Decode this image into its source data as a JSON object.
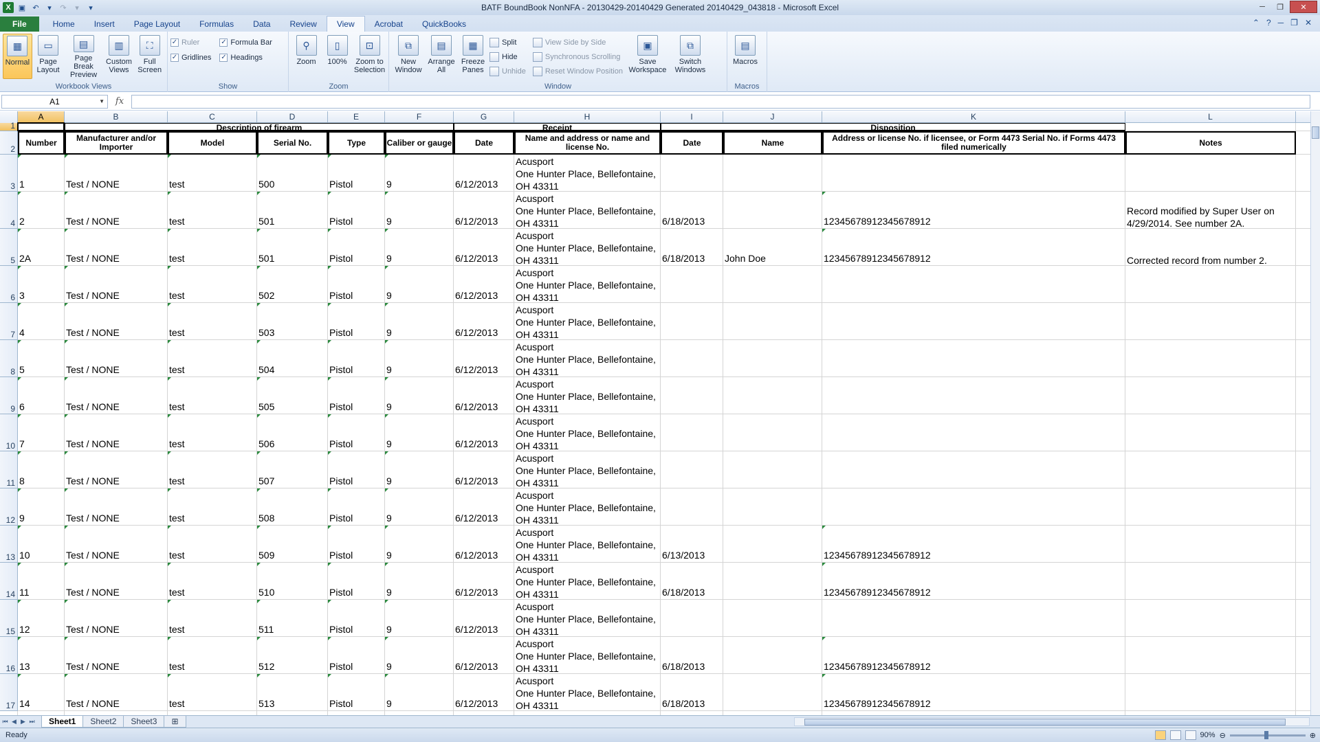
{
  "window": {
    "title": "BATF BoundBook NonNFA - 20130429-20140429 Generated 20140429_043818  -  Microsoft Excel"
  },
  "tabs": [
    "File",
    "Home",
    "Insert",
    "Page Layout",
    "Formulas",
    "Data",
    "Review",
    "View",
    "Acrobat",
    "QuickBooks"
  ],
  "active_tab": "View",
  "ribbon": {
    "workbook_views": {
      "label": "Workbook Views",
      "normal": "Normal",
      "page_layout_1": "Page",
      "page_layout_2": "Layout",
      "page_break_1": "Page Break",
      "page_break_2": "Preview",
      "custom_1": "Custom",
      "custom_2": "Views",
      "full_1": "Full",
      "full_2": "Screen"
    },
    "show": {
      "label": "Show",
      "ruler": "Ruler",
      "formula_bar": "Formula Bar",
      "gridlines": "Gridlines",
      "headings": "Headings"
    },
    "zoom": {
      "label": "Zoom",
      "zoom": "Zoom",
      "hundred": "100%",
      "zoom_sel_1": "Zoom to",
      "zoom_sel_2": "Selection"
    },
    "window": {
      "label": "Window",
      "new_1": "New",
      "new_2": "Window",
      "arrange_1": "Arrange",
      "arrange_2": "All",
      "freeze_1": "Freeze",
      "freeze_2": "Panes",
      "split": "Split",
      "hide": "Hide",
      "unhide": "Unhide",
      "side_by_side": "View Side by Side",
      "sync_scroll": "Synchronous Scrolling",
      "reset_pos": "Reset Window Position",
      "save_ws_1": "Save",
      "save_ws_2": "Workspace",
      "switch_1": "Switch",
      "switch_2": "Windows"
    },
    "macros": {
      "label": "Macros",
      "macros": "Macros"
    }
  },
  "formula_bar": {
    "name_box": "A1",
    "fx": "fx",
    "formula": ""
  },
  "columns": [
    "A",
    "B",
    "C",
    "D",
    "E",
    "F",
    "G",
    "H",
    "I",
    "J",
    "K",
    "L"
  ],
  "group_headers": {
    "description": "Description of firearm",
    "receipt": "Receipt",
    "disposition": "Disposition"
  },
  "field_headers": {
    "number": "Number",
    "manufacturer": "Manufacturer and/or Importer",
    "model": "Model",
    "serial": "Serial No.",
    "type": "Type",
    "caliber": "Caliber or gauge",
    "receipt_date": "Date",
    "receipt_name": "Name and address or name and license No.",
    "disp_date": "Date",
    "disp_name": "Name",
    "disp_address": "Address or license No. if licensee, or Form 4473 Serial No. if Forms 4473 filed numerically",
    "notes": "Notes"
  },
  "rows": [
    {
      "row": "3",
      "num": "1",
      "mfr": "Test / NONE",
      "model": "test",
      "serial": "500",
      "type": "Pistol",
      "cal": "9",
      "rdate": "6/12/2013",
      "addr1": "Acusport",
      "addr2": "One Hunter Place, Bellefontaine,",
      "addr3": "OH 43311",
      "ddate": "",
      "dname": "",
      "daddr": "",
      "notes1": "",
      "notes2": ""
    },
    {
      "row": "4",
      "num": "2",
      "mfr": "Test / NONE",
      "model": "test",
      "serial": "501",
      "type": "Pistol",
      "cal": "9",
      "rdate": "6/12/2013",
      "addr1": "Acusport",
      "addr2": "One Hunter Place, Bellefontaine,",
      "addr3": "OH 43311",
      "ddate": "6/18/2013",
      "dname": "",
      "daddr": "12345678912345678912",
      "notes1": "Record modified by Super User on",
      "notes2": "4/29/2014.  See number 2A."
    },
    {
      "row": "5",
      "num": "2A",
      "mfr": "Test / NONE",
      "model": "test",
      "serial": "501",
      "type": "Pistol",
      "cal": "9",
      "rdate": "6/12/2013",
      "addr1": "Acusport",
      "addr2": "One Hunter Place, Bellefontaine,",
      "addr3": "OH 43311",
      "ddate": "6/18/2013",
      "dname": "John Doe",
      "daddr": "12345678912345678912",
      "notes1": "",
      "notes2": "Corrected record from number 2."
    },
    {
      "row": "6",
      "num": "3",
      "mfr": "Test / NONE",
      "model": "test",
      "serial": "502",
      "type": "Pistol",
      "cal": "9",
      "rdate": "6/12/2013",
      "addr1": "Acusport",
      "addr2": "One Hunter Place, Bellefontaine,",
      "addr3": "OH 43311",
      "ddate": "",
      "dname": "",
      "daddr": "",
      "notes1": "",
      "notes2": ""
    },
    {
      "row": "7",
      "num": "4",
      "mfr": "Test / NONE",
      "model": "test",
      "serial": "503",
      "type": "Pistol",
      "cal": "9",
      "rdate": "6/12/2013",
      "addr1": "Acusport",
      "addr2": "One Hunter Place, Bellefontaine,",
      "addr3": "OH 43311",
      "ddate": "",
      "dname": "",
      "daddr": "",
      "notes1": "",
      "notes2": ""
    },
    {
      "row": "8",
      "num": "5",
      "mfr": "Test / NONE",
      "model": "test",
      "serial": "504",
      "type": "Pistol",
      "cal": "9",
      "rdate": "6/12/2013",
      "addr1": "Acusport",
      "addr2": "One Hunter Place, Bellefontaine,",
      "addr3": "OH 43311",
      "ddate": "",
      "dname": "",
      "daddr": "",
      "notes1": "",
      "notes2": ""
    },
    {
      "row": "9",
      "num": "6",
      "mfr": "Test / NONE",
      "model": "test",
      "serial": "505",
      "type": "Pistol",
      "cal": "9",
      "rdate": "6/12/2013",
      "addr1": "Acusport",
      "addr2": "One Hunter Place, Bellefontaine,",
      "addr3": "OH 43311",
      "ddate": "",
      "dname": "",
      "daddr": "",
      "notes1": "",
      "notes2": ""
    },
    {
      "row": "10",
      "num": "7",
      "mfr": "Test / NONE",
      "model": "test",
      "serial": "506",
      "type": "Pistol",
      "cal": "9",
      "rdate": "6/12/2013",
      "addr1": "Acusport",
      "addr2": "One Hunter Place, Bellefontaine,",
      "addr3": "OH 43311",
      "ddate": "",
      "dname": "",
      "daddr": "",
      "notes1": "",
      "notes2": ""
    },
    {
      "row": "11",
      "num": "8",
      "mfr": "Test / NONE",
      "model": "test",
      "serial": "507",
      "type": "Pistol",
      "cal": "9",
      "rdate": "6/12/2013",
      "addr1": "Acusport",
      "addr2": "One Hunter Place, Bellefontaine,",
      "addr3": "OH 43311",
      "ddate": "",
      "dname": "",
      "daddr": "",
      "notes1": "",
      "notes2": ""
    },
    {
      "row": "12",
      "num": "9",
      "mfr": "Test / NONE",
      "model": "test",
      "serial": "508",
      "type": "Pistol",
      "cal": "9",
      "rdate": "6/12/2013",
      "addr1": "Acusport",
      "addr2": "One Hunter Place, Bellefontaine,",
      "addr3": "OH 43311",
      "ddate": "",
      "dname": "",
      "daddr": "",
      "notes1": "",
      "notes2": ""
    },
    {
      "row": "13",
      "num": "10",
      "mfr": "Test / NONE",
      "model": "test",
      "serial": "509",
      "type": "Pistol",
      "cal": "9",
      "rdate": "6/12/2013",
      "addr1": "Acusport",
      "addr2": "One Hunter Place, Bellefontaine,",
      "addr3": "OH 43311",
      "ddate": "6/13/2013",
      "dname": "",
      "daddr": "12345678912345678912",
      "notes1": "",
      "notes2": ""
    },
    {
      "row": "14",
      "num": "11",
      "mfr": "Test / NONE",
      "model": "test",
      "serial": "510",
      "type": "Pistol",
      "cal": "9",
      "rdate": "6/12/2013",
      "addr1": "Acusport",
      "addr2": "One Hunter Place, Bellefontaine,",
      "addr3": "OH 43311",
      "ddate": "6/18/2013",
      "dname": "",
      "daddr": "12345678912345678912",
      "notes1": "",
      "notes2": ""
    },
    {
      "row": "15",
      "num": "12",
      "mfr": "Test / NONE",
      "model": "test",
      "serial": "511",
      "type": "Pistol",
      "cal": "9",
      "rdate": "6/12/2013",
      "addr1": "Acusport",
      "addr2": "One Hunter Place, Bellefontaine,",
      "addr3": "OH 43311",
      "ddate": "",
      "dname": "",
      "daddr": "",
      "notes1": "",
      "notes2": ""
    },
    {
      "row": "16",
      "num": "13",
      "mfr": "Test / NONE",
      "model": "test",
      "serial": "512",
      "type": "Pistol",
      "cal": "9",
      "rdate": "6/12/2013",
      "addr1": "Acusport",
      "addr2": "One Hunter Place, Bellefontaine,",
      "addr3": "OH 43311",
      "ddate": "6/18/2013",
      "dname": "",
      "daddr": "12345678912345678912",
      "notes1": "",
      "notes2": ""
    },
    {
      "row": "17",
      "num": "14",
      "mfr": "Test / NONE",
      "model": "test",
      "serial": "513",
      "type": "Pistol",
      "cal": "9",
      "rdate": "6/12/2013",
      "addr1": "Acusport",
      "addr2": "One Hunter Place, Bellefontaine,",
      "addr3": "OH 43311",
      "ddate": "6/18/2013",
      "dname": "",
      "daddr": "12345678912345678912",
      "notes1": "",
      "notes2": ""
    }
  ],
  "row_numbers_header": [
    "1",
    "2"
  ],
  "sheets": [
    "Sheet1",
    "Sheet2",
    "Sheet3"
  ],
  "active_sheet": "Sheet1",
  "status": {
    "ready": "Ready",
    "zoom": "90%"
  }
}
